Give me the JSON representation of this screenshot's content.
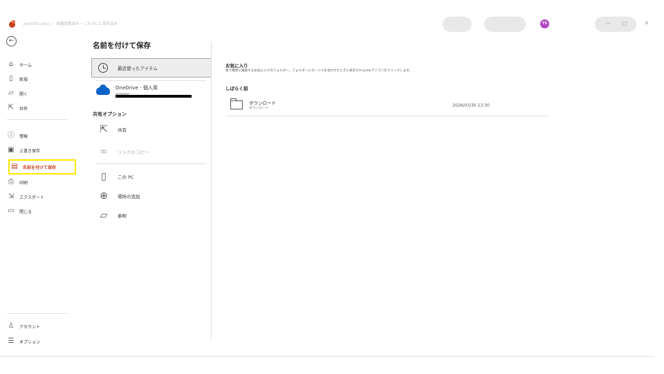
{
  "titlebar": {
    "doc_name": "ppt35E5.pptx",
    "separator": "-",
    "status": "自動回復済み • この PC に保存済み",
    "avatar_initials": "TS",
    "minimize": "—",
    "restore": "▢",
    "close": "✕"
  },
  "sidebar": {
    "back_icon": "←",
    "items": [
      {
        "label": "ホーム",
        "icon": "home-icon"
      },
      {
        "label": "新規",
        "icon": "new-document-icon"
      },
      {
        "label": "開く",
        "icon": "open-folder-icon"
      },
      {
        "label": "共有",
        "icon": "share-icon"
      },
      {
        "label": "情報",
        "icon": "info-icon"
      },
      {
        "label": "上書き保存",
        "icon": "save-icon"
      },
      {
        "label": "名前を付けて保存",
        "icon": "save-as-icon"
      },
      {
        "label": "印刷",
        "icon": "print-icon"
      },
      {
        "label": "エクスポート",
        "icon": "export-icon"
      },
      {
        "label": "閉じる",
        "icon": "close-folder-icon"
      },
      {
        "label": "アカウント",
        "icon": "account-icon"
      },
      {
        "label": "オプション",
        "icon": "options-icon"
      }
    ]
  },
  "main": {
    "title": "名前を付けて保存",
    "locations": {
      "recent": "最近使ったアイテム",
      "onedrive": "OneDrive - 個人用",
      "shared_heading": "共有オプション",
      "share": "共有",
      "copy_link": "リンクのコピー",
      "this_pc": "この PC",
      "add_place": "場所の追加",
      "browse": "参照"
    },
    "favorites_heading": "お気に入り",
    "favorites_desc": "後で簡単に検索するお気に入りのフォルダー。フォルダーにカーソルを合わせたときに表示されるstarアイコンをクリックします。",
    "recent_heading": "しばらく前",
    "files": [
      {
        "name": "ダウンロード",
        "path": "ダウンロード",
        "date": "2026/03/30 13:30"
      }
    ]
  },
  "colors": {
    "accent": "#c43e1c",
    "highlight": "#ffe600",
    "onedrive": "#0a64c8",
    "avatar": "#b146c2"
  }
}
